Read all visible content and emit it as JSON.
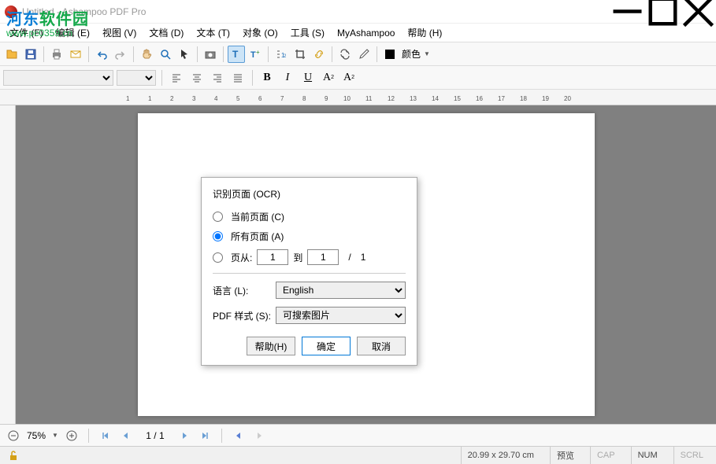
{
  "window": {
    "title": "Untitled - Ashampoo PDF Pro"
  },
  "menu": {
    "file": "文件 (F)",
    "edit": "编辑 (E)",
    "view": "视图 (V)",
    "document": "文档 (D)",
    "text": "文本 (T)",
    "object": "对象 (O)",
    "tools": "工具 (S)",
    "myashampoo": "MyAshampoo",
    "help": "帮助 (H)"
  },
  "toolbar": {
    "color_label": "颜色"
  },
  "dialog": {
    "title": "识别页面 (OCR)",
    "radio_current": "当前页面 (C)",
    "radio_all": "所有页面 (A)",
    "radio_pages": "页从:",
    "to_label": "到",
    "from_value": "1",
    "to_value": "1",
    "slash_label": "/",
    "total_pages": "1",
    "lang_label": "语言 (L):",
    "lang_value": "English",
    "style_label": "PDF 样式 (S):",
    "style_value": "可搜索图片",
    "help_btn": "帮助(H)",
    "ok_btn": "确定",
    "cancel_btn": "取消",
    "selected_radio": "all"
  },
  "status1": {
    "zoom": "75%",
    "page": "1 / 1"
  },
  "status2": {
    "dimensions": "20.99 x 29.70 cm",
    "preview": "预览",
    "cap": "CAP",
    "num": "NUM",
    "scrl": "SCRL"
  },
  "watermark": {
    "line1_a": "河东",
    "line1_b": "软件园",
    "line2": "www.pc0359.cn"
  }
}
